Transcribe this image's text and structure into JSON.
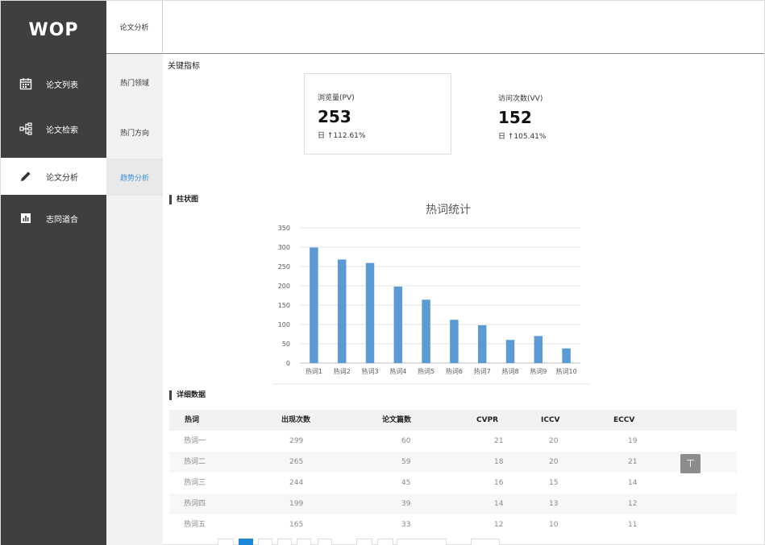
{
  "app": {
    "logo": "WOP"
  },
  "sidebar": {
    "items": [
      {
        "label": "论文列表",
        "icon": "calendar-icon"
      },
      {
        "label": "论文检索",
        "icon": "sitemap-icon"
      },
      {
        "label": "论文分析",
        "icon": "pencil-icon",
        "active": true
      },
      {
        "label": "志同道合",
        "icon": "bar-chart-icon"
      }
    ]
  },
  "subnav": {
    "header": "论文分析",
    "items": [
      {
        "label": "热门领域"
      },
      {
        "label": "热门方向"
      },
      {
        "label": "趋势分析",
        "active": true
      }
    ]
  },
  "kpi": {
    "section_title": "关键指标",
    "cards": [
      {
        "label": "浏览量(PV)",
        "value": "253",
        "change": "日 ↑112.61%"
      },
      {
        "label": "访问次数(VV)",
        "value": "152",
        "change": "日 ↑105.41%"
      }
    ]
  },
  "chart_section": {
    "title": "柱状图"
  },
  "chart_data": {
    "type": "bar",
    "title": "热词统计",
    "categories": [
      "热词1",
      "热词2",
      "热词3",
      "热词4",
      "热词5",
      "热词6",
      "热词7",
      "热词8",
      "热词9",
      "热词10"
    ],
    "values": [
      299,
      268,
      259,
      198,
      164,
      112,
      98,
      60,
      70,
      38
    ],
    "ylim": [
      0,
      350
    ],
    "yticks": [
      0,
      50,
      100,
      150,
      200,
      250,
      300,
      350
    ],
    "grid": true,
    "color": "#5b9bd5"
  },
  "table_section": {
    "title": "详细数据"
  },
  "table": {
    "columns": [
      "热词",
      "出现次数",
      "论文篇数",
      "CVPR",
      "ICCV",
      "ECCV"
    ],
    "rows": [
      [
        "热词一",
        "299",
        "60",
        "21",
        "20",
        "19"
      ],
      [
        "热词二",
        "265",
        "59",
        "18",
        "20",
        "21"
      ],
      [
        "热词三",
        "244",
        "45",
        "16",
        "15",
        "14"
      ],
      [
        "热词四",
        "199",
        "39",
        "14",
        "13",
        "12"
      ],
      [
        "热词五",
        "165",
        "33",
        "12",
        "10",
        "11"
      ]
    ]
  },
  "back_to_top": {
    "label": "⊤"
  },
  "colors": {
    "sidebar_bg": "#3f3f3f",
    "accent": "#3a8fd8",
    "bar": "#5b9bd5"
  }
}
